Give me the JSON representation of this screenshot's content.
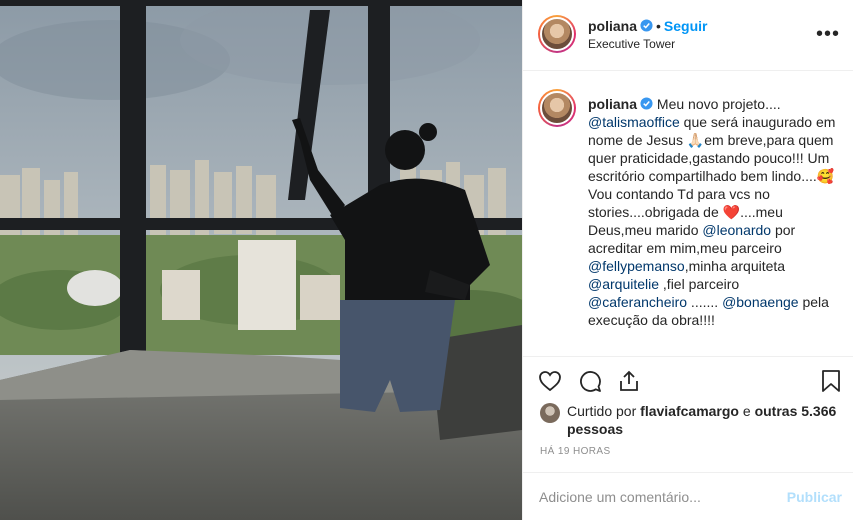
{
  "post": {
    "username": "poliana",
    "separator": "•",
    "follow_label": "Seguir",
    "location": "Executive Tower",
    "more_label": "•••"
  },
  "caption": {
    "username": "poliana",
    "parts": [
      {
        "t": "text",
        "v": "Meu novo projeto.... "
      },
      {
        "t": "mention",
        "v": "@talismaoffice"
      },
      {
        "t": "text",
        "v": " que será inaugurado em nome de Jesus 🙏🏻em breve,para quem quer praticidade,gastando pouco!!! Um escritório compartilhado bem lindo....🥰Vou contando Td para vcs no stories....obrigada de ❤️....meu Deus,meu marido "
      },
      {
        "t": "mention",
        "v": "@leonardo"
      },
      {
        "t": "text",
        "v": " por acreditar em mim,meu parceiro "
      },
      {
        "t": "mention",
        "v": "@fellypemanso"
      },
      {
        "t": "text",
        "v": ",minha arquiteta "
      },
      {
        "t": "mention",
        "v": "@arquitelie"
      },
      {
        "t": "text",
        "v": " ,fiel parceiro "
      },
      {
        "t": "mention",
        "v": "@caferancheiro"
      },
      {
        "t": "text",
        "v": " ....... "
      },
      {
        "t": "mention",
        "v": "@bonaenge"
      },
      {
        "t": "text",
        "v": " pela execução da obra!!!!"
      }
    ]
  },
  "likes": {
    "prefix": "Curtido por",
    "liker": "flaviafcamargo",
    "middle": "e",
    "others": "outras 5.366 pessoas"
  },
  "timestamp": "HÁ 19 HORAS",
  "comment": {
    "placeholder": "Adicione um comentário...",
    "publish_label": "Publicar"
  },
  "icons": {
    "verified": "verified-badge-icon",
    "like": "heart-icon",
    "comment": "comment-icon",
    "share": "share-icon",
    "save": "bookmark-icon",
    "more": "more-options-icon"
  },
  "colors": {
    "link": "#00376b",
    "follow": "#0095f6",
    "publish_disabled": "#b2dffc",
    "muted": "#8e8e8e",
    "verified": "#3897f0"
  }
}
